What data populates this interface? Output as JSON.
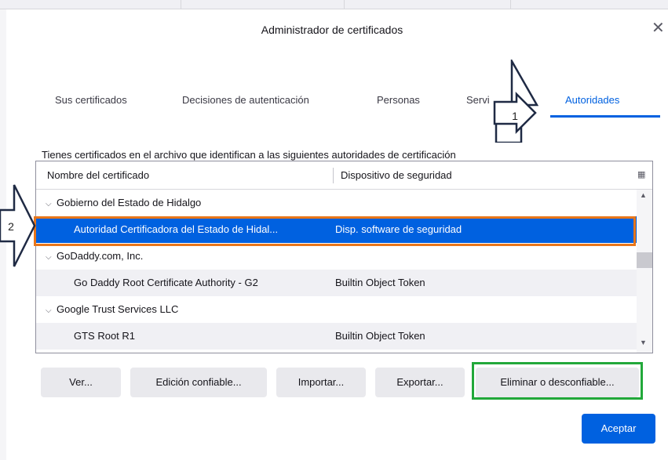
{
  "dialog": {
    "title": "Administrador de certificados",
    "close_label": "✕"
  },
  "tabs": [
    {
      "label": "Sus certificados",
      "active": false
    },
    {
      "label": "Decisiones de autenticación",
      "active": false
    },
    {
      "label": "Personas",
      "active": false
    },
    {
      "label": "Servi",
      "active": false
    },
    {
      "label": "Autoridades",
      "active": true
    }
  ],
  "description": "Tienes certificados en el archivo que identifican a las siguientes autoridades de certificación",
  "tree": {
    "columns": [
      "Nombre del certificado",
      "Dispositivo de seguridad"
    ],
    "column_picker_icon": "column-picker-icon",
    "rows": [
      {
        "name": "Gobierno del Estado de Hidalgo",
        "device": "",
        "group": true
      },
      {
        "name": "Autoridad Certificadora del Estado de Hidal...",
        "device": "Disp. software de seguridad",
        "group": false,
        "selected": true
      },
      {
        "name": "GoDaddy.com, Inc.",
        "device": "",
        "group": true
      },
      {
        "name": "Go Daddy Root Certificate Authority - G2",
        "device": "Builtin Object Token",
        "group": false
      },
      {
        "name": "Google Trust Services LLC",
        "device": "",
        "group": true
      },
      {
        "name": "GTS Root R1",
        "device": "Builtin Object Token",
        "group": false
      }
    ]
  },
  "buttons": {
    "view": "Ver...",
    "trust": "Edición confiable...",
    "import": "Importar...",
    "export": "Exportar...",
    "delete": "Eliminar o desconfiable...",
    "accept": "Aceptar"
  },
  "annotations": {
    "arrow1": "1",
    "arrow2": "2"
  },
  "colors": {
    "accent": "#0061e0",
    "highlight_orange": "#e8761b",
    "highlight_green": "#22a83a"
  }
}
